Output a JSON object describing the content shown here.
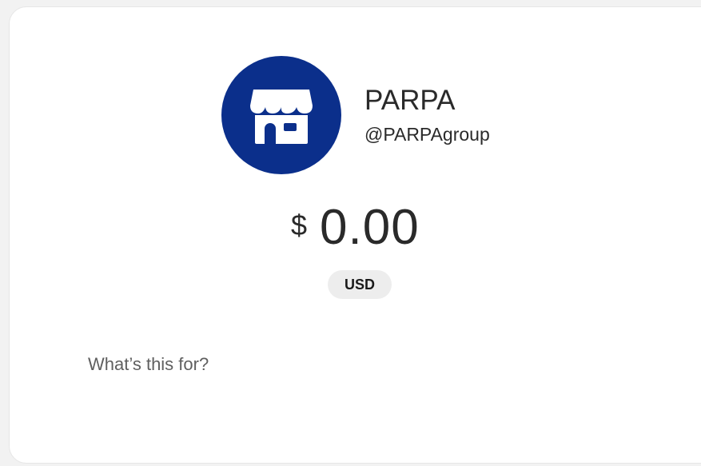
{
  "merchant": {
    "name": "PARPA",
    "handle": "@PARPAgroup",
    "avatar_icon": "storefront-icon",
    "avatar_color": "#0b2f8b"
  },
  "payment": {
    "currency_symbol": "$",
    "amount": "0.00",
    "currency_code": "USD"
  },
  "note": {
    "placeholder": "What’s this for?",
    "value": ""
  }
}
